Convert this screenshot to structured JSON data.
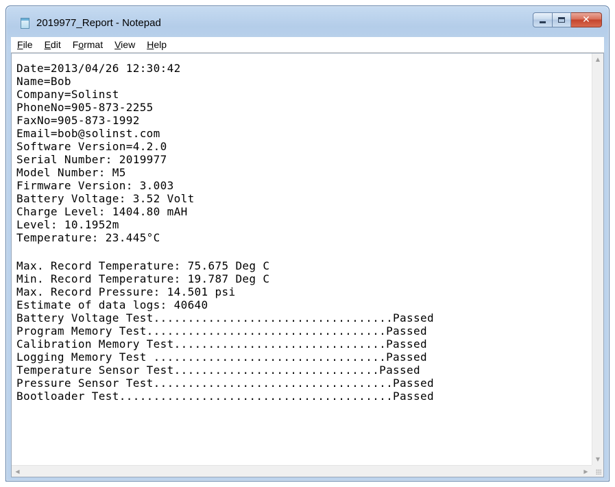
{
  "window": {
    "title": "2019977_Report - Notepad"
  },
  "caption_buttons": {
    "close_glyph": "✕"
  },
  "menu": [
    {
      "accel": "F",
      "rest": "ile"
    },
    {
      "accel": "E",
      "rest": "dit"
    },
    {
      "pre": "F",
      "accel": "o",
      "rest": "rmat"
    },
    {
      "accel": "V",
      "rest": "iew"
    },
    {
      "accel": "H",
      "rest": "elp"
    }
  ],
  "document": {
    "lines": [
      "Date=2013/04/26 12:30:42",
      "Name=Bob",
      "Company=Solinst",
      "PhoneNo=905-873-2255",
      "FaxNo=905-873-1992",
      "Email=bob@solinst.com",
      "Software Version=4.2.0",
      "Serial Number: 2019977",
      "Model Number: M5",
      "Firmware Version: 3.003",
      "Battery Voltage: 3.52 Volt",
      "Charge Level: 1404.80 mAH",
      "Level: 10.1952m",
      "Temperature: 23.445°C",
      "",
      "Max. Record Temperature: 75.675 Deg C",
      "Min. Record Temperature: 19.787 Deg C",
      "Max. Record Pressure: 14.501 psi",
      "Estimate of data logs: 40640",
      "Battery Voltage Test...................................Passed",
      "Program Memory Test...................................Passed",
      "Calibration Memory Test...............................Passed",
      "Logging Memory Test ..................................Passed",
      "Temperature Sensor Test..............................Passed",
      "Pressure Sensor Test...................................Passed",
      "Bootloader Test........................................Passed"
    ]
  },
  "scrollbars": {
    "up": "▲",
    "down": "▼",
    "left": "◀",
    "right": "▶"
  }
}
